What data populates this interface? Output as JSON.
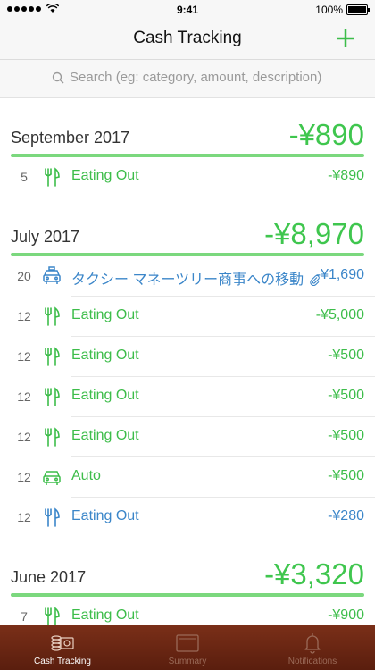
{
  "status_bar": {
    "time": "9:41",
    "battery": "100%",
    "battery_level": 1.0
  },
  "nav": {
    "title": "Cash Tracking",
    "add_icon": "plus-icon"
  },
  "search": {
    "placeholder": "Search (eg: category, amount, description)"
  },
  "sections": [
    {
      "title": "September 2017",
      "total": "-¥890",
      "rows": [
        {
          "day": "5",
          "icon": "fork-knife-icon",
          "label": "Eating Out",
          "amount": "-¥890",
          "color": "green"
        }
      ]
    },
    {
      "title": "July 2017",
      "total": "-¥8,970",
      "rows": [
        {
          "day": "20",
          "icon": "taxi-icon",
          "label": "タクシー マネーツリー商事への移動",
          "amount": "-¥1,690",
          "color": "blue",
          "attachment": true
        },
        {
          "day": "12",
          "icon": "fork-knife-icon",
          "label": "Eating Out",
          "amount": "-¥5,000",
          "color": "green"
        },
        {
          "day": "12",
          "icon": "fork-knife-icon",
          "label": "Eating Out",
          "amount": "-¥500",
          "color": "green"
        },
        {
          "day": "12",
          "icon": "fork-knife-icon",
          "label": "Eating Out",
          "amount": "-¥500",
          "color": "green"
        },
        {
          "day": "12",
          "icon": "fork-knife-icon",
          "label": "Eating Out",
          "amount": "-¥500",
          "color": "green"
        },
        {
          "day": "12",
          "icon": "car-icon",
          "label": "Auto",
          "amount": "-¥500",
          "color": "green"
        },
        {
          "day": "12",
          "icon": "fork-knife-icon",
          "label": "Eating Out",
          "amount": "-¥280",
          "color": "blue"
        }
      ]
    },
    {
      "title": "June 2017",
      "total": "-¥3,320",
      "rows": [
        {
          "day": "7",
          "icon": "fork-knife-icon",
          "label": "Eating Out",
          "amount": "-¥900",
          "color": "green"
        }
      ]
    }
  ],
  "tabs": [
    {
      "label": "Cash Tracking",
      "icon": "cash-icon",
      "active": true
    },
    {
      "label": "Summary",
      "icon": "folder-icon",
      "active": false
    },
    {
      "label": "Notifications",
      "icon": "bell-icon",
      "active": false
    }
  ],
  "colors": {
    "green": "#3dbd4a",
    "blue": "#3b86c9",
    "header_total": "#3fc64e",
    "underline": "#7bd87e",
    "tab_bar": "#6a2614"
  }
}
